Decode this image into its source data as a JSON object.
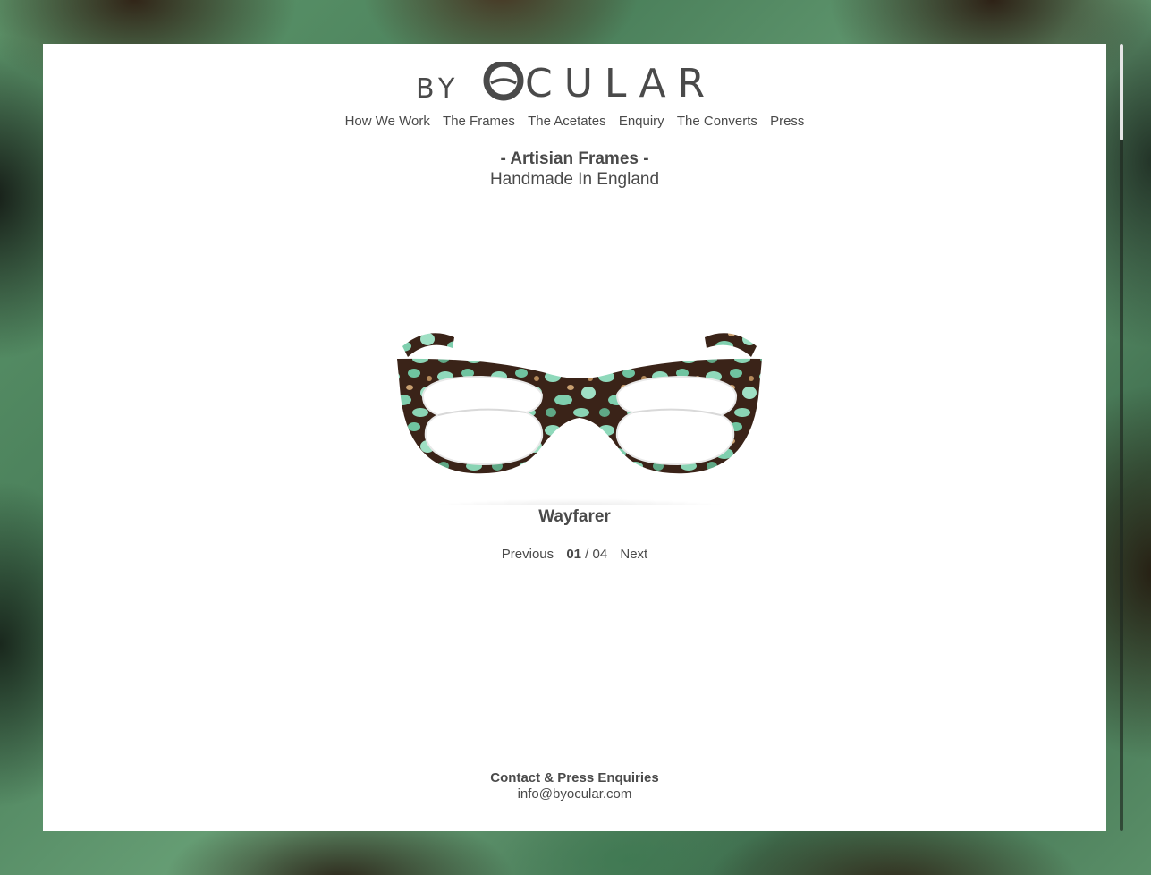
{
  "brand": {
    "logo_prefix": "BY",
    "logo_main": "CULAR"
  },
  "nav": {
    "items": [
      "How We Work",
      "The Frames",
      "The Acetates",
      "Enquiry",
      "The Converts",
      "Press"
    ]
  },
  "tagline": {
    "line1": "- Artisian Frames -",
    "line2": "Handmade In England"
  },
  "product": {
    "name": "Wayfarer",
    "image_icon": "eyeglasses-image"
  },
  "pager": {
    "previous_label": "Previous",
    "current": "01",
    "separator": "/",
    "total": "04",
    "next_label": "Next"
  },
  "footer": {
    "heading": "Contact & Press Enquiries",
    "email": "info@byocular.com"
  },
  "colors": {
    "text": "#4a4a4a",
    "frame_green": "#7fd1b0",
    "frame_brown": "#3a2318"
  }
}
